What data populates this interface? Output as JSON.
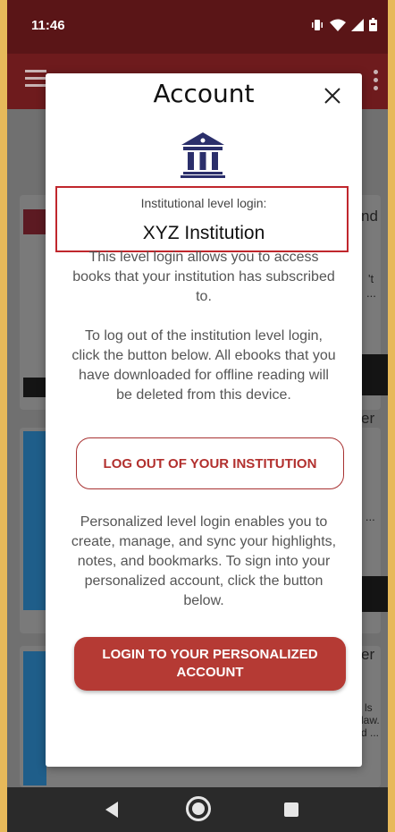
{
  "status_bar": {
    "time": "11:46"
  },
  "background": {
    "snippets": [
      "nd",
      "'t",
      "...",
      "er",
      "n ...",
      "er",
      "ls",
      "law.",
      "d ..."
    ]
  },
  "modal": {
    "title": "Account",
    "institution_label": "Institutional level login:",
    "institution_name": "XYZ Institution",
    "description": "This level login allows you to access books that your institution has subscribed to.",
    "logout_info": "To log out of the institution level login, click the button below. All ebooks that you have downloaded for offline reading will be deleted from this device.",
    "logout_button": "LOG OUT OF YOUR INSTITUTION",
    "personal_info": "Personalized level login enables you to create, manage, and sync your highlights, notes, and bookmarks. To sign into your personalized account, click the button below.",
    "login_button": "LOGIN TO YOUR PERSONALIZED ACCOUNT"
  },
  "colors": {
    "accent": "#b53a34",
    "highlight_box": "#c0272d",
    "app_bar": "#6e1b1d",
    "frame": "#e7b95a"
  },
  "icons": [
    "menu-icon",
    "more-vert-icon",
    "close-icon",
    "institution-icon",
    "vibrate-icon",
    "wifi-icon",
    "signal-icon",
    "battery-icon",
    "back-icon",
    "home-icon",
    "recents-icon"
  ]
}
